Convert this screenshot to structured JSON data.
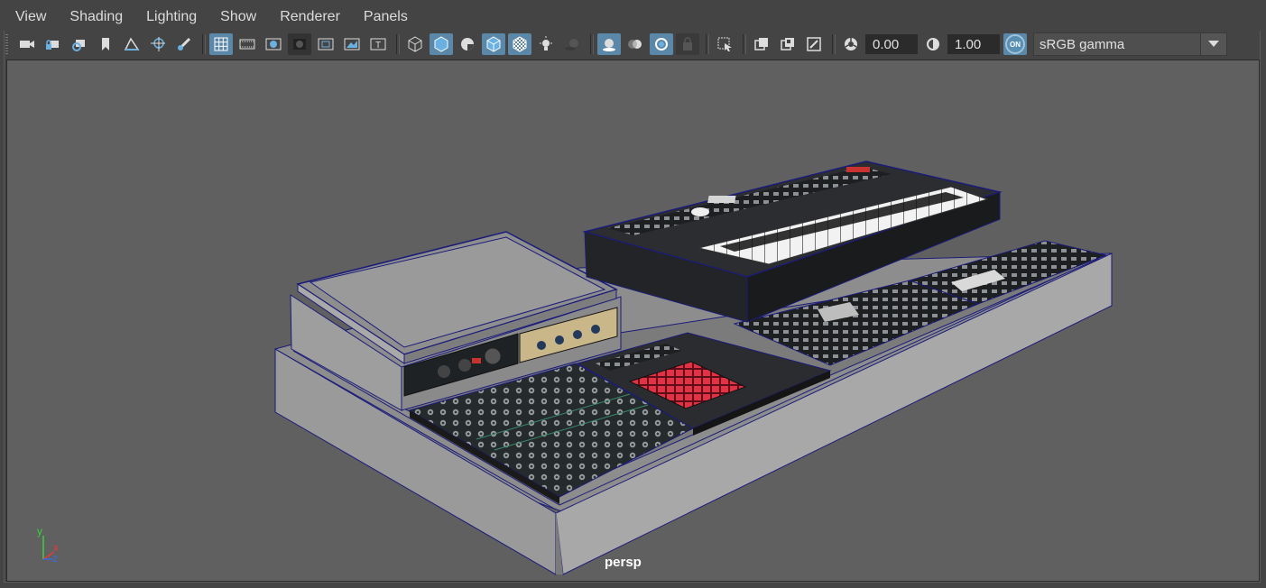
{
  "menubar": {
    "items": [
      "View",
      "Shading",
      "Lighting",
      "Show",
      "Renderer",
      "Panels"
    ]
  },
  "toolbar": {
    "exposure_value": "0.00",
    "gamma_value": "1.00",
    "color_mgmt_badge": "ON",
    "view_transform": "sRGB gamma",
    "icons": [
      "camera-icon",
      "camera-lock-icon",
      "camera-attributes-icon",
      "bookmark-icon",
      "image-plane-icon",
      "2d-pan-zoom-icon",
      "grease-pencil-icon",
      "grid-icon",
      "film-gate-icon",
      "resolution-gate-icon",
      "gate-mask-icon",
      "field-chart-icon",
      "safe-action-icon",
      "safe-title-icon",
      "wireframe-icon",
      "smooth-shade-icon",
      "bounding-box-icon",
      "wireframe-on-shaded-icon",
      "xray-icon",
      "default-lighting-icon",
      "shadows-icon",
      "screen-space-ao-icon",
      "motion-blur-icon",
      "multisample-aa-icon",
      "depth-of-field-icon",
      "isolate-select-icon",
      "xray-joints-icon",
      "xray-active-icon",
      "backface-culling-icon",
      "exposure-icon",
      "gamma-icon",
      "color-management-icon"
    ]
  },
  "viewport": {
    "camera_label": "persp",
    "axis": {
      "y": "y",
      "x": "x",
      "z": "z"
    }
  },
  "colors": {
    "ui_bg": "#444444",
    "viewport_bg": "#606060",
    "active_button": "#5b87a8",
    "wire_blue": "#1b1b7a",
    "model_grey": "#8a8a8a",
    "axis_x": "#e23b3b",
    "axis_y": "#3bd13b",
    "axis_z": "#3b6be2"
  }
}
